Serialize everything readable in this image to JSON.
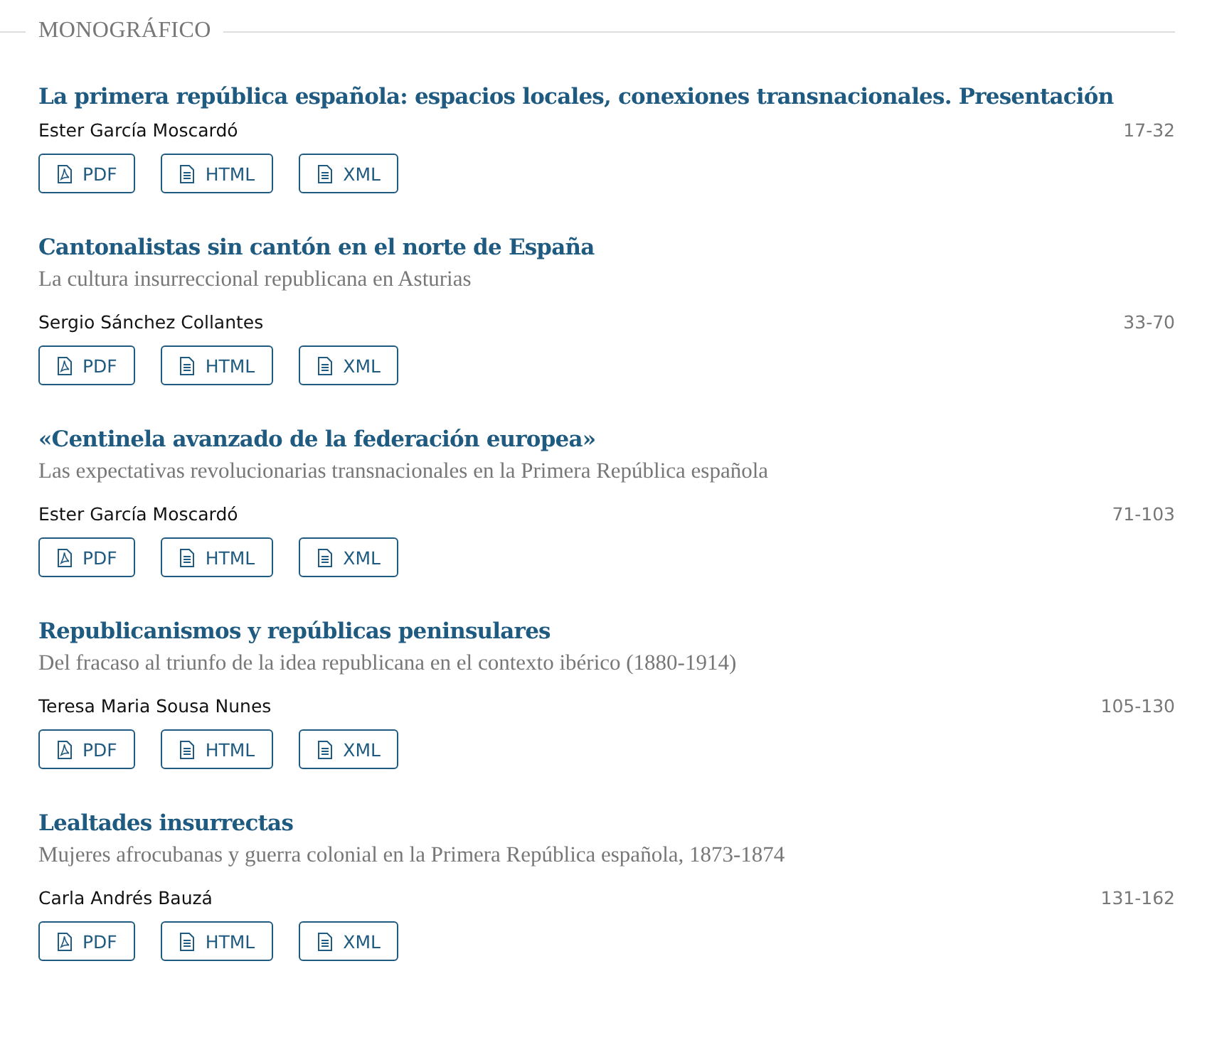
{
  "section": {
    "heading": "MONOGRÁFICO"
  },
  "articles": [
    {
      "title": "La primera república española: espacios locales, conexiones transnacionales. Presentación",
      "author": "Ester García Moscardó",
      "pages": "17-32",
      "galleys": [
        {
          "kind": "pdf",
          "label": "PDF"
        },
        {
          "kind": "doc",
          "label": "HTML"
        },
        {
          "kind": "doc",
          "label": "XML"
        }
      ]
    },
    {
      "title": "Cantonalistas sin cantón en el norte de España",
      "subtitle": "La cultura insurreccional republicana en Asturias",
      "author": "Sergio Sánchez Collantes",
      "pages": "33-70",
      "galleys": [
        {
          "kind": "pdf",
          "label": "PDF"
        },
        {
          "kind": "doc",
          "label": "HTML"
        },
        {
          "kind": "doc",
          "label": "XML"
        }
      ]
    },
    {
      "title": "«Centinela avanzado de la federación europea»",
      "subtitle": "Las expectativas revolucionarias transnacionales en la Primera República española",
      "author": "Ester García Moscardó",
      "pages": "71-103",
      "galleys": [
        {
          "kind": "pdf",
          "label": "PDF"
        },
        {
          "kind": "doc",
          "label": "HTML"
        },
        {
          "kind": "doc",
          "label": "XML"
        }
      ]
    },
    {
      "title": "Republicanismos y repúblicas peninsulares",
      "subtitle": "Del fracaso al triunfo de la idea republicana en el contexto ibérico (1880-1914)",
      "author": "Teresa Maria Sousa Nunes",
      "pages": "105-130",
      "galleys": [
        {
          "kind": "pdf",
          "label": "PDF"
        },
        {
          "kind": "doc",
          "label": "HTML"
        },
        {
          "kind": "doc",
          "label": "XML"
        }
      ]
    },
    {
      "title": "Lealtades insurrectas",
      "subtitle": "Mujeres afrocubanas y guerra colonial en la Primera República española, 1873-1874",
      "author": "Carla Andrés Bauzá",
      "pages": "131-162",
      "galleys": [
        {
          "kind": "pdf",
          "label": "PDF"
        },
        {
          "kind": "doc",
          "label": "HTML"
        },
        {
          "kind": "doc",
          "label": "XML"
        }
      ]
    }
  ]
}
